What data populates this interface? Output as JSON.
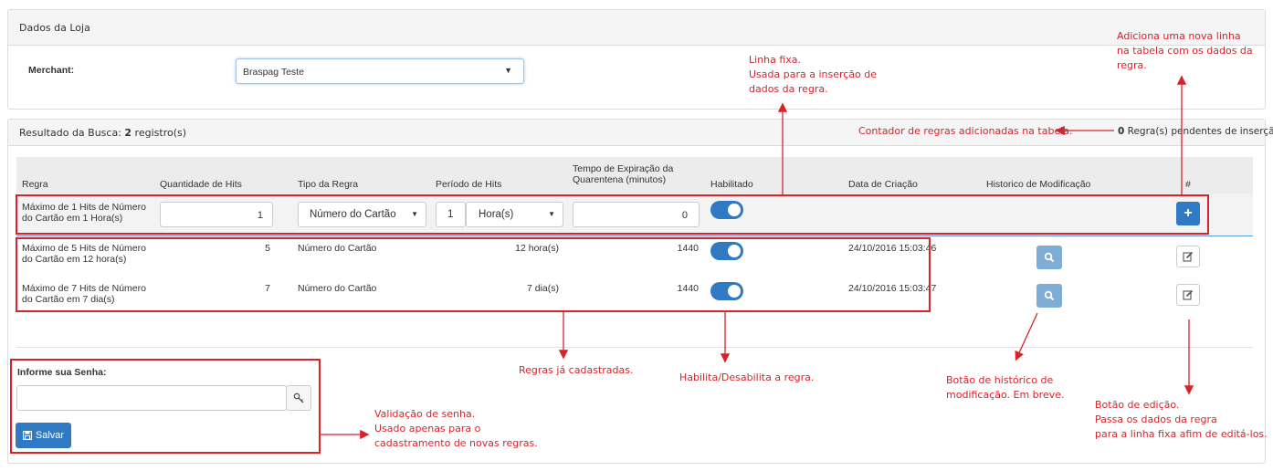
{
  "store_panel": {
    "title": "Dados da Loja",
    "merchant_label": "Merchant:",
    "merchant_value": "Braspag Teste"
  },
  "results_panel": {
    "title_prefix": "Resultado da Busca: ",
    "count": "2",
    "title_suffix": " registro(s)",
    "pending_count": "0",
    "pending_label": " Regra(s) pendentes de inserção"
  },
  "table": {
    "headers": {
      "regra": "Regra",
      "hits": "Quantidade de Hits",
      "tipo": "Tipo da Regra",
      "periodo": "Período de Hits",
      "tempo": "Tempo de Expiração da Quarentena (minutos)",
      "habilitado": "Habilitado",
      "data": "Data de Criação",
      "historico": "Historico de Modificação",
      "acao": "#"
    },
    "new_row": {
      "regra": "Máximo de 1 Hits de Número do Cartão em 1 Hora(s)",
      "hits": "1",
      "tipo": "Número do Cartão",
      "periodo_qtd": "1",
      "periodo_unidade": "Hora(s)",
      "tempo": "0",
      "habilitado": true
    },
    "rows": [
      {
        "regra": "Máximo de 5 Hits de Número do Cartão em 12 hora(s)",
        "hits": "5",
        "tipo": "Número do Cartão",
        "periodo": "12 hora(s)",
        "tempo": "1440",
        "habilitado": true,
        "data": "24/10/2016 15:03:46"
      },
      {
        "regra": "Máximo de 7 Hits de Número do Cartão em 7 dia(s)",
        "hits": "7",
        "tipo": "Número do Cartão",
        "periodo": "7 dia(s)",
        "tempo": "1440",
        "habilitado": true,
        "data": "24/10/2016 15:03:47"
      }
    ]
  },
  "password": {
    "label": "Informe sua Senha:",
    "value": "",
    "save_label": "Salvar"
  },
  "annotations": {
    "add_row": [
      "Adiciona uma nova linha",
      "na tabela com os dados da",
      "regra."
    ],
    "fixed_row": [
      "Linha fixa.",
      "Usada para a inserção de",
      "dados da regra."
    ],
    "counter": "Contador de regras adicionadas na tabela.",
    "registered": "Regras já cadastradas.",
    "toggle": "Habilita/Desabilita a regra.",
    "history": [
      "Botão de histórico de",
      "modificação. Em breve."
    ],
    "edit": [
      "Botão de edição.",
      "Passa os dados da regra",
      "para a linha fixa afim de editá-los."
    ],
    "password": [
      "Validação de senha.",
      "Usado apenas para o",
      "cadastramento de novas regras."
    ]
  },
  "colors": {
    "primary": "#2f7ac3",
    "info_button": "#7fadd6",
    "annotation": "#d8232a"
  },
  "icons": {
    "dropdown": "caret-down-icon",
    "search": "search-icon",
    "edit": "edit-icon",
    "add": "plus-icon",
    "key": "key-icon",
    "save": "floppy-disk-icon"
  }
}
